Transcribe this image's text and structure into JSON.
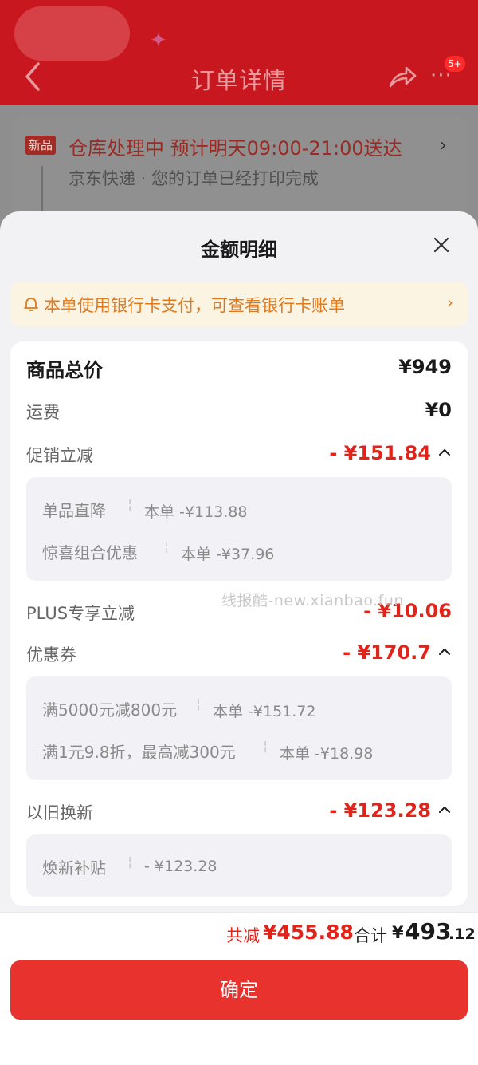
{
  "background": {
    "title": "订单详情",
    "badge": "5+",
    "tag": "新品",
    "status": "仓库处理中 预计明天09:00-21:00送达",
    "sub": "京东快递 · 您的订单已经打印完成"
  },
  "sheet": {
    "title": "金额明细",
    "notice": "本单使用银行卡支付，可查看银行卡账单"
  },
  "rows": {
    "total_label": "商品总价",
    "total_value": "¥949",
    "shipping_label": "运费",
    "shipping_value": "¥0",
    "promo_label": "促销立减",
    "promo_value": "- ¥151.84",
    "promo_items": [
      {
        "label": "单品直降",
        "value": "本单 -¥113.88"
      },
      {
        "label": "惊喜组合优惠",
        "value": "本单 -¥37.96"
      }
    ],
    "plus_label": "PLUS专享立减",
    "plus_value": "- ¥10.06",
    "coupon_label": "优惠券",
    "coupon_value": "- ¥170.7",
    "coupon_items": [
      {
        "label": "满5000元减800元",
        "value": "本单 -¥151.72"
      },
      {
        "label": "满1元9.8折，最高减300元",
        "value": "本单 -¥18.98"
      }
    ],
    "tradein_label": "以旧换新",
    "tradein_value": "- ¥123.28",
    "tradein_items": [
      {
        "label": "焕新补贴",
        "value": "- ¥123.28"
      }
    ]
  },
  "watermark": "线报酷-new.xianbao.fun",
  "footer": {
    "reduce_label": "共减",
    "reduce_value": "¥455.88",
    "total_label": "合计",
    "total_symbol": "¥",
    "total_int": "493",
    "total_dec": ".12",
    "confirm": "确定"
  },
  "colors": {
    "accent_red": "#e2231a",
    "button_red": "#e8322d",
    "notice_orange": "#e07a1f"
  }
}
